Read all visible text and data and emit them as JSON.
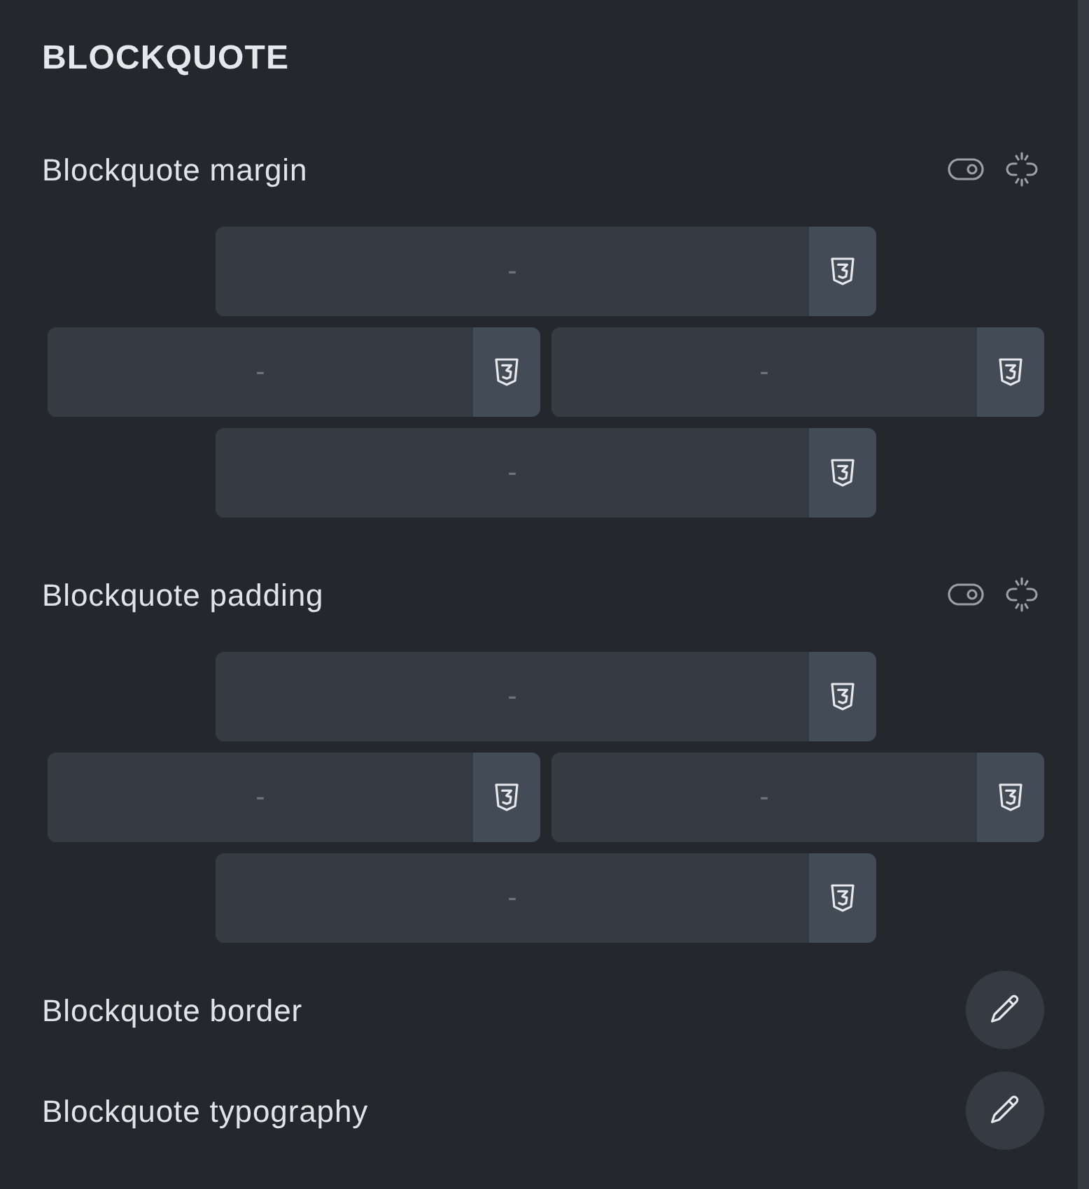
{
  "section_title": "BLOCKQUOTE",
  "spacing_controls": [
    {
      "label": "Blockquote margin",
      "top": {
        "placeholder": "-"
      },
      "left": {
        "placeholder": "-"
      },
      "right": {
        "placeholder": "-"
      },
      "bottom": {
        "placeholder": "-"
      }
    },
    {
      "label": "Blockquote padding",
      "top": {
        "placeholder": "-"
      },
      "left": {
        "placeholder": "-"
      },
      "right": {
        "placeholder": "-"
      },
      "bottom": {
        "placeholder": "-"
      }
    }
  ],
  "edit_rows": [
    {
      "label": "Blockquote border"
    },
    {
      "label": "Blockquote typography"
    }
  ]
}
